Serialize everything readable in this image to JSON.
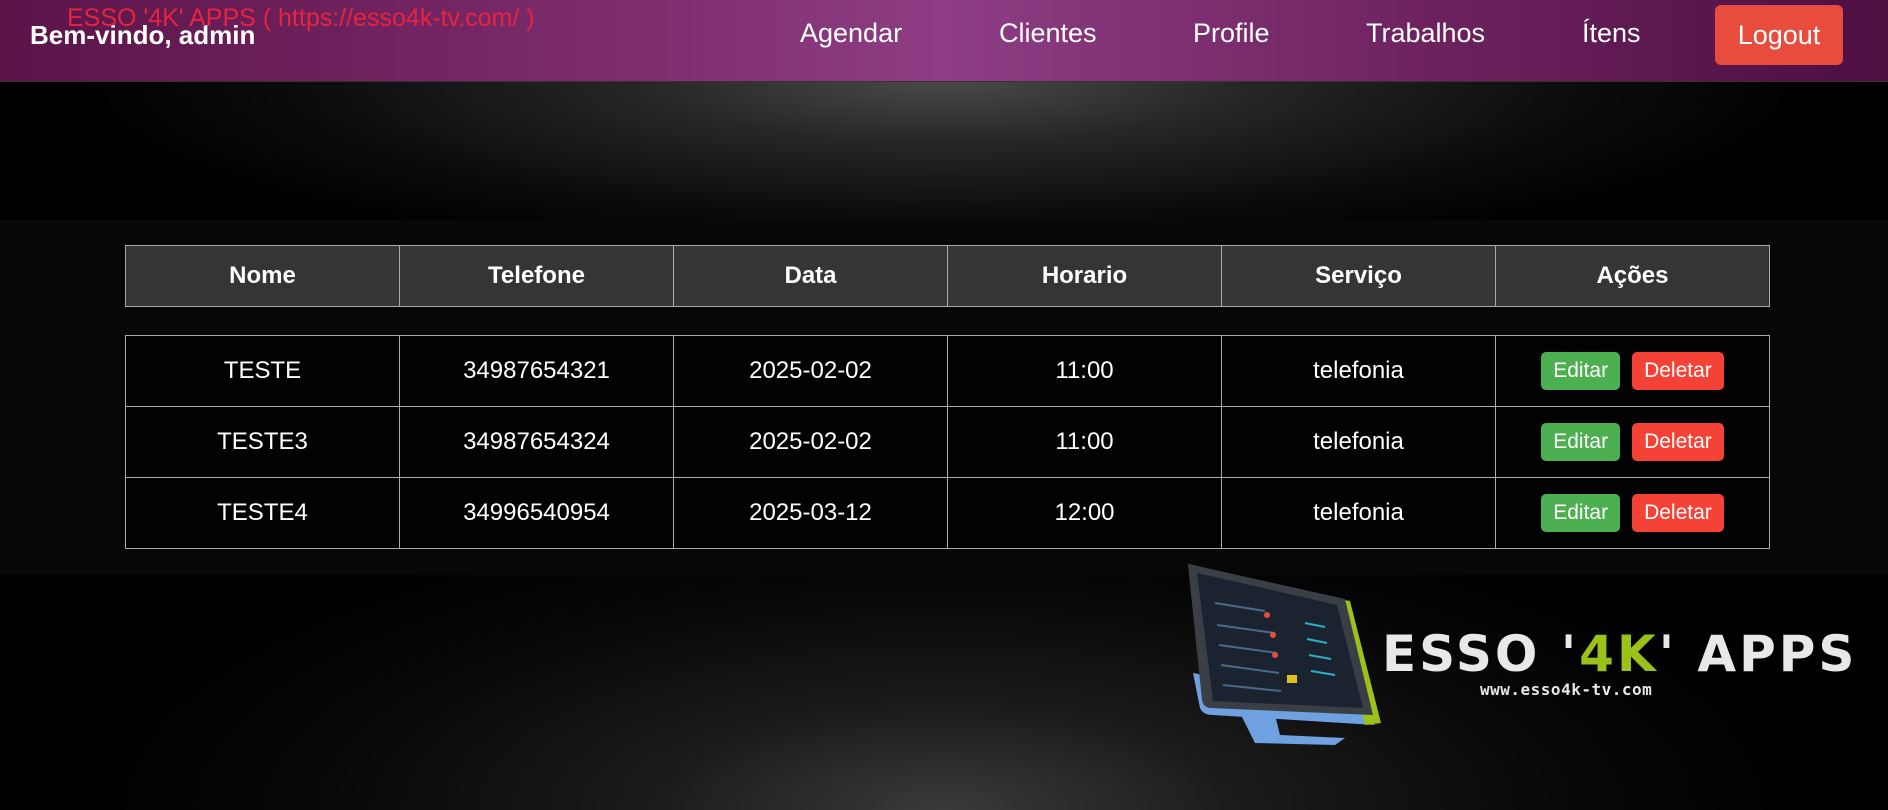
{
  "navbar": {
    "welcome": "Bem-vindo, admin",
    "watermark": "ESSO '4K' APPS (  https://esso4k-tv.com/ )",
    "items": [
      "Agendar",
      "Clientes",
      "Profile",
      "Trabalhos",
      "Ítens"
    ],
    "logout_label": "Logout"
  },
  "table": {
    "headers": [
      "Nome",
      "Telefone",
      "Data",
      "Horario",
      "Serviço",
      "Ações"
    ],
    "rows": [
      {
        "nome": "TESTE",
        "telefone": "34987654321",
        "data": "2025-02-02",
        "horario": "11:00",
        "servico": "telefonia"
      },
      {
        "nome": "TESTE3",
        "telefone": "34987654324",
        "data": "2025-02-02",
        "horario": "11:00",
        "servico": "telefonia"
      },
      {
        "nome": "TESTE4",
        "telefone": "34996540954",
        "data": "2025-03-12",
        "horario": "12:00",
        "servico": "telefonia"
      }
    ],
    "edit_label": "Editar",
    "delete_label": "Deletar"
  },
  "logo": {
    "text_a": "ESSO '",
    "text_accent": "4K",
    "text_b": "' APPS",
    "url": "www.esso4k-tv.com"
  },
  "colors": {
    "logout": "#e74c3c",
    "edit": "#4caf50",
    "delete": "#f44336",
    "watermark": "#e8233f",
    "logo_accent": "#9cc21a"
  }
}
